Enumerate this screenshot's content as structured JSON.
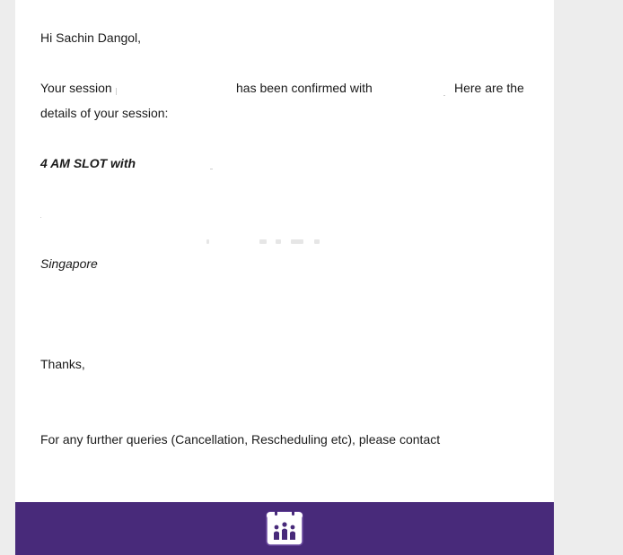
{
  "email": {
    "greeting": "Hi Sachin Dangol,",
    "session_prefix": "Your session",
    "confirmed_text": "has been confirmed with",
    "here_are_the": "Here are the",
    "details_text": "details of your session:",
    "slot_text": "4 AM SLOT with",
    "location_text": "Singapore",
    "thanks_text": "Thanks,",
    "queries_text": "For any further queries (Cancellation, Rescheduling etc), please contact"
  },
  "footer": {
    "logo_icon": "calendar-people-icon",
    "background_color": "#482a7a"
  }
}
